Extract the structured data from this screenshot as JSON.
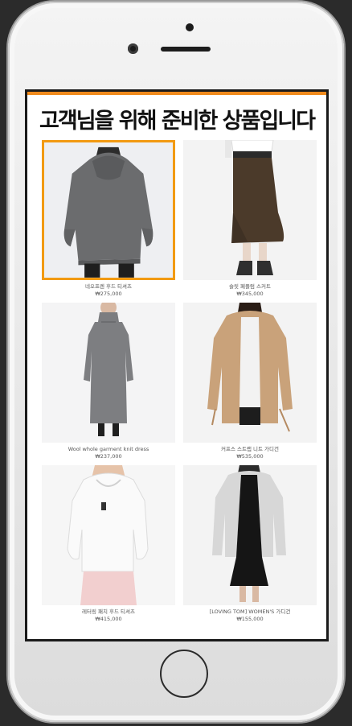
{
  "screen": {
    "title": "고객님을 위해 준비한 상품입니다",
    "accent_color": "#f08a1c",
    "selected_outline_color": "#f29a12"
  },
  "products": [
    {
      "name": "네오프렌 후드 티셔츠",
      "price": "₩275,000",
      "image": "gray-hoodie",
      "selected": true
    },
    {
      "name": "슬릿 페플럼 스커트",
      "price": "₩345,000",
      "image": "brown-midi-skirt",
      "selected": false
    },
    {
      "name": "Wool whole garment knit dress",
      "price": "₩237,000",
      "image": "gray-knit-dress",
      "selected": false
    },
    {
      "name": "커프스 스트랩 니트 가디건",
      "price": "₩535,000",
      "image": "camel-cardigan",
      "selected": false
    },
    {
      "name": "레터링 패치 후드 티셔츠",
      "price": "₩415,000",
      "image": "white-hoodie",
      "selected": false
    },
    {
      "name": "[LOVING TOM] WOMEN'S 가디건",
      "price": "₩155,000",
      "image": "gray-cardigan-black-dress",
      "selected": false
    }
  ],
  "device": {
    "icons": [
      "front-camera-icon",
      "earpiece-speaker-icon",
      "home-button-icon"
    ]
  }
}
